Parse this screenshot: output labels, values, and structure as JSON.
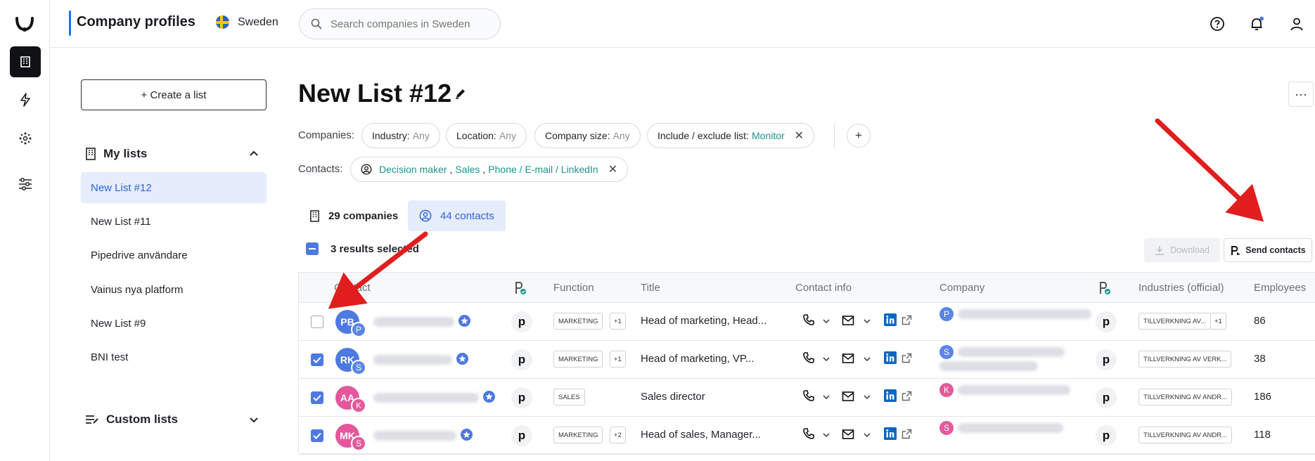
{
  "header": {
    "title": "Company profiles",
    "country": "Sweden",
    "search_placeholder": "Search companies in Sweden"
  },
  "sidebar": {
    "create_label": "+ Create a list",
    "my_lists_label": "My lists",
    "lists": [
      "New List #12",
      "New List #11",
      "Pipedrive användare",
      "Vainus nya platform",
      "New List #9",
      "BNI test"
    ],
    "active_list": "New List #12",
    "custom_lists_label": "Custom lists"
  },
  "main": {
    "title": "New List #12",
    "companies_label": "Companies:",
    "contacts_label": "Contacts:",
    "filters": {
      "industry": {
        "label": "Industry:",
        "value": "Any"
      },
      "location": {
        "label": "Location:",
        "value": "Any"
      },
      "size": {
        "label": "Company size:",
        "value": "Any"
      },
      "include": {
        "label": "Include / exclude list:",
        "value": "Monitor"
      }
    },
    "contact_filter": {
      "decision": "Decision maker",
      "sales": "Sales",
      "channels": "Phone / E-mail / LinkedIn"
    },
    "tabs": {
      "companies": "29 companies",
      "contacts": "44 contacts"
    },
    "selected_text": "3 results selected",
    "download_label": "Download",
    "send_label": "Send contacts"
  },
  "table": {
    "headers": {
      "contact": "Contact",
      "function": "Function",
      "title": "Title",
      "contact_info": "Contact info",
      "company": "Company",
      "industries": "Industries (official)",
      "employees": "Employees"
    },
    "rows": [
      {
        "checked": false,
        "initials": "PB",
        "sub": "P",
        "color": "#4d79e0",
        "sub_color": "#5b86e8",
        "function": "MARKETING",
        "extra": "+1",
        "title": "Head of marketing, Head...",
        "company_initial": "P",
        "company_color": "#5b86e8",
        "industry": "TILLVERKNING AV...",
        "industry_extra": "+1",
        "employees": "86"
      },
      {
        "checked": true,
        "initials": "RK",
        "sub": "S",
        "color": "#4d79e0",
        "sub_color": "#5b86e8",
        "function": "MARKETING",
        "extra": "+1",
        "title": "Head of marketing, VP...",
        "company_initial": "S",
        "company_color": "#5b86e8",
        "industry": "TILLVERKNING AV VERK...",
        "industry_extra": "",
        "employees": "38"
      },
      {
        "checked": true,
        "initials": "AA",
        "sub": "K",
        "color": "#e5579b",
        "sub_color": "#e55a9b",
        "function": "SALES",
        "extra": "",
        "title": "Sales director",
        "company_initial": "K",
        "company_color": "#e55a9b",
        "industry": "TILLVERKNING AV ANDR...",
        "industry_extra": "",
        "employees": "186"
      },
      {
        "checked": true,
        "initials": "MK",
        "sub": "S",
        "color": "#e5579b",
        "sub_color": "#e55a9b",
        "function": "MARKETING",
        "extra": "+2",
        "title": "Head of sales, Manager...",
        "company_initial": "S",
        "company_color": "#e55a9b",
        "industry": "TILLVERKNING AV ANDR...",
        "industry_extra": "",
        "employees": "118"
      }
    ]
  },
  "colors": {
    "accent": "#4d79e0",
    "teal": "#19958a",
    "active_bg": "#e5ecfb"
  },
  "icons": [
    "logo-icon",
    "building-icon",
    "bolt-icon",
    "network-icon",
    "sliders-icon",
    "search-icon",
    "help-icon",
    "bell-icon",
    "user-icon",
    "edit-icon",
    "phone-icon",
    "mail-icon",
    "linkedin-icon",
    "external-link-icon",
    "pipedrive-icon"
  ]
}
